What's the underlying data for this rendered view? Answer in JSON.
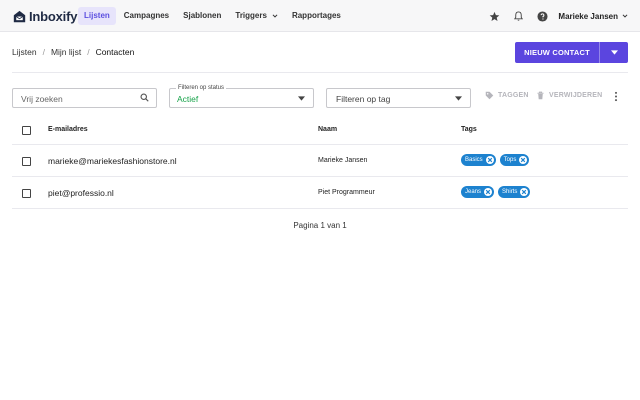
{
  "brand": {
    "name": "Inboxify",
    "accent": "#5b45df"
  },
  "nav": {
    "items": [
      {
        "label": "Lijsten",
        "active": true
      },
      {
        "label": "Campagnes"
      },
      {
        "label": "Sjablonen"
      },
      {
        "label": "Triggers",
        "has_dropdown": true
      },
      {
        "label": "Rapportages"
      }
    ]
  },
  "topbar": {
    "icons": [
      "star-icon",
      "bell-icon",
      "help-icon"
    ],
    "user_name": "Marieke Jansen"
  },
  "breadcrumb": [
    "Lijsten",
    "Mijn lijst",
    "Contacten"
  ],
  "primary_action": {
    "label": "NIEUW CONTACT"
  },
  "filters": {
    "search_placeholder": "Vrij zoeken",
    "status_label": "Filteren op status",
    "status_value": "Actief",
    "tag_placeholder": "Filteren op tag"
  },
  "actions": {
    "tag": "TAGGEN",
    "delete": "VERWIJDEREN"
  },
  "table": {
    "headers": {
      "email": "E-mailadres",
      "name": "Naam",
      "tags": "Tags"
    },
    "rows": [
      {
        "email": "marieke@mariekesfashionstore.nl",
        "name": "Marieke Jansen",
        "tags": [
          "Basics",
          "Tops"
        ]
      },
      {
        "email": "piet@professio.nl",
        "name": "Piet Programmeur",
        "tags": [
          "Jeans",
          "Shirts"
        ]
      }
    ]
  },
  "pagination": "Pagina 1 van 1"
}
